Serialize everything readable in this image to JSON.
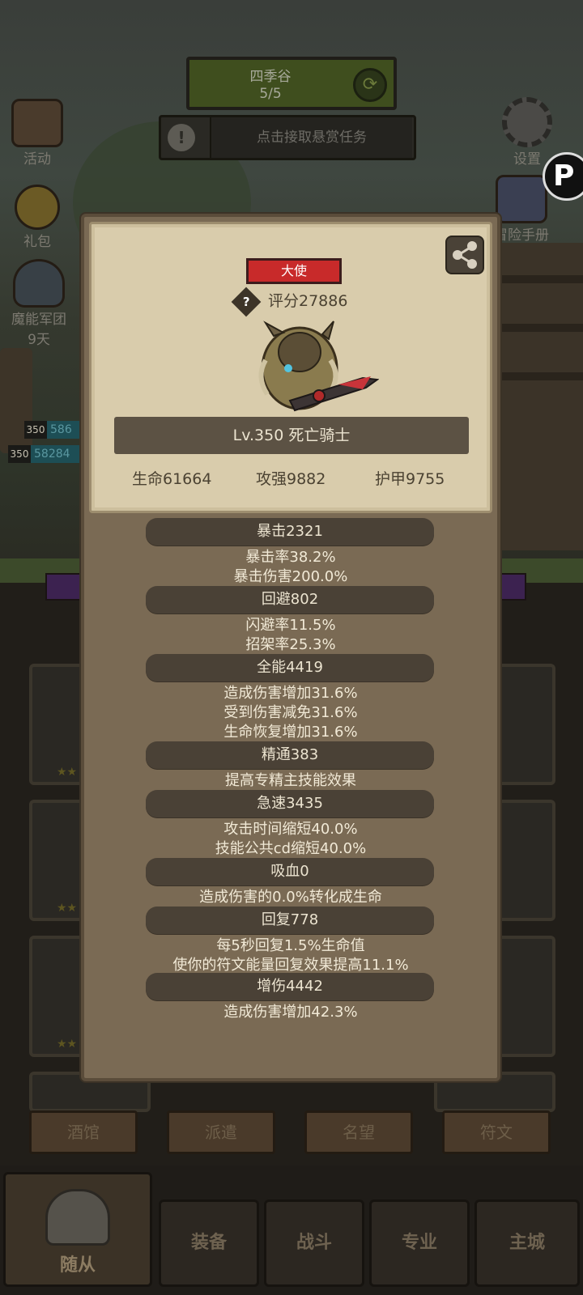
{
  "background": {
    "quest": {
      "name": "四季谷",
      "progress": "5/5"
    },
    "bounty_text": "点击接取悬赏任务",
    "side_left": [
      {
        "label": "活动",
        "icon": "calendar-icon"
      },
      {
        "label": "礼包",
        "icon": "gift-coin-icon"
      },
      {
        "label": "魔能军团",
        "sub": "9天",
        "icon": "legion-icon"
      }
    ],
    "side_right": [
      {
        "label": "设置",
        "icon": "gear-icon"
      },
      {
        "label": "冒险手册",
        "icon": "book-icon"
      }
    ],
    "hp_rows": [
      {
        "level": "350",
        "value": "586"
      },
      {
        "level": "350",
        "value": "58284"
      }
    ],
    "tabs": [
      "酒馆",
      "派遣",
      "名望",
      "符文"
    ],
    "nav": [
      "随从",
      "装备",
      "战斗",
      "专业",
      "主城"
    ]
  },
  "hero": {
    "rank": "大使",
    "score": "评分27886",
    "name": "Lv.350 死亡骑士",
    "stats": [
      "生命61664",
      "攻强9882",
      "护甲9755"
    ]
  },
  "details": [
    {
      "title": "暴击2321",
      "lines": [
        "暴击率38.2%",
        "暴击伤害200.0%"
      ]
    },
    {
      "title": "回避802",
      "lines": [
        "闪避率11.5%",
        "招架率25.3%"
      ]
    },
    {
      "title": "全能4419",
      "lines": [
        "造成伤害增加31.6%",
        "受到伤害减免31.6%",
        "生命恢复增加31.6%"
      ]
    },
    {
      "title": "精通383",
      "lines": [
        "提高专精主技能效果"
      ]
    },
    {
      "title": "急速3435",
      "lines": [
        "攻击时间缩短40.0%",
        "技能公共cd缩短40.0%"
      ]
    },
    {
      "title": "吸血0",
      "lines": [
        "造成伤害的0.0%转化成生命"
      ]
    },
    {
      "title": "回复778",
      "lines": [
        "每5秒回复1.5%生命值",
        "使你的符文能量回复效果提高11.1%"
      ]
    },
    {
      "title": "增伤4442",
      "lines": [
        "造成伤害增加42.3%"
      ]
    }
  ]
}
